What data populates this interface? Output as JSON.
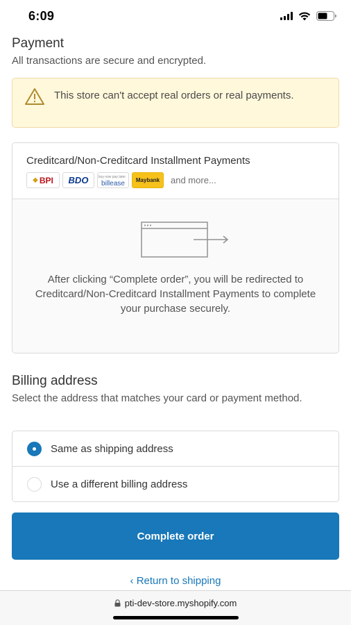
{
  "status_bar": {
    "time": "6:09",
    "icons": [
      "signal-icon",
      "wifi-icon",
      "battery-icon"
    ]
  },
  "payment": {
    "title": "Payment",
    "subtitle": "All transactions are secure and encrypted.",
    "notice": {
      "icon": "warning-icon",
      "text": "This store can't accept real orders or real payments."
    },
    "method": {
      "name": "Creditcard/Non-Creditcard Installment Payments",
      "logos": {
        "bpi": "BPI",
        "bdo": "BDO",
        "billease_tag": "buy now pay later",
        "billease": "billease",
        "maybank": "Maybank"
      },
      "and_more": "and more...",
      "redirect_text": "After clicking “Complete order”, you will be redirected to Creditcard/Non-Creditcard Installment Payments to complete your purchase securely."
    }
  },
  "billing": {
    "title": "Billing address",
    "subtitle": "Select the address that matches your card or payment method.",
    "options": [
      {
        "label": "Same as shipping address",
        "selected": true
      },
      {
        "label": "Use a different billing address",
        "selected": false
      }
    ]
  },
  "actions": {
    "complete_order": "Complete order",
    "return_link": "‹ Return to shipping"
  },
  "browser": {
    "url": "pti-dev-store.myshopify.com"
  },
  "colors": {
    "accent": "#1878b9",
    "notice_bg": "#fff8db",
    "notice_icon": "#b08a2e",
    "border": "#d9d9d9",
    "text": "#333333"
  }
}
